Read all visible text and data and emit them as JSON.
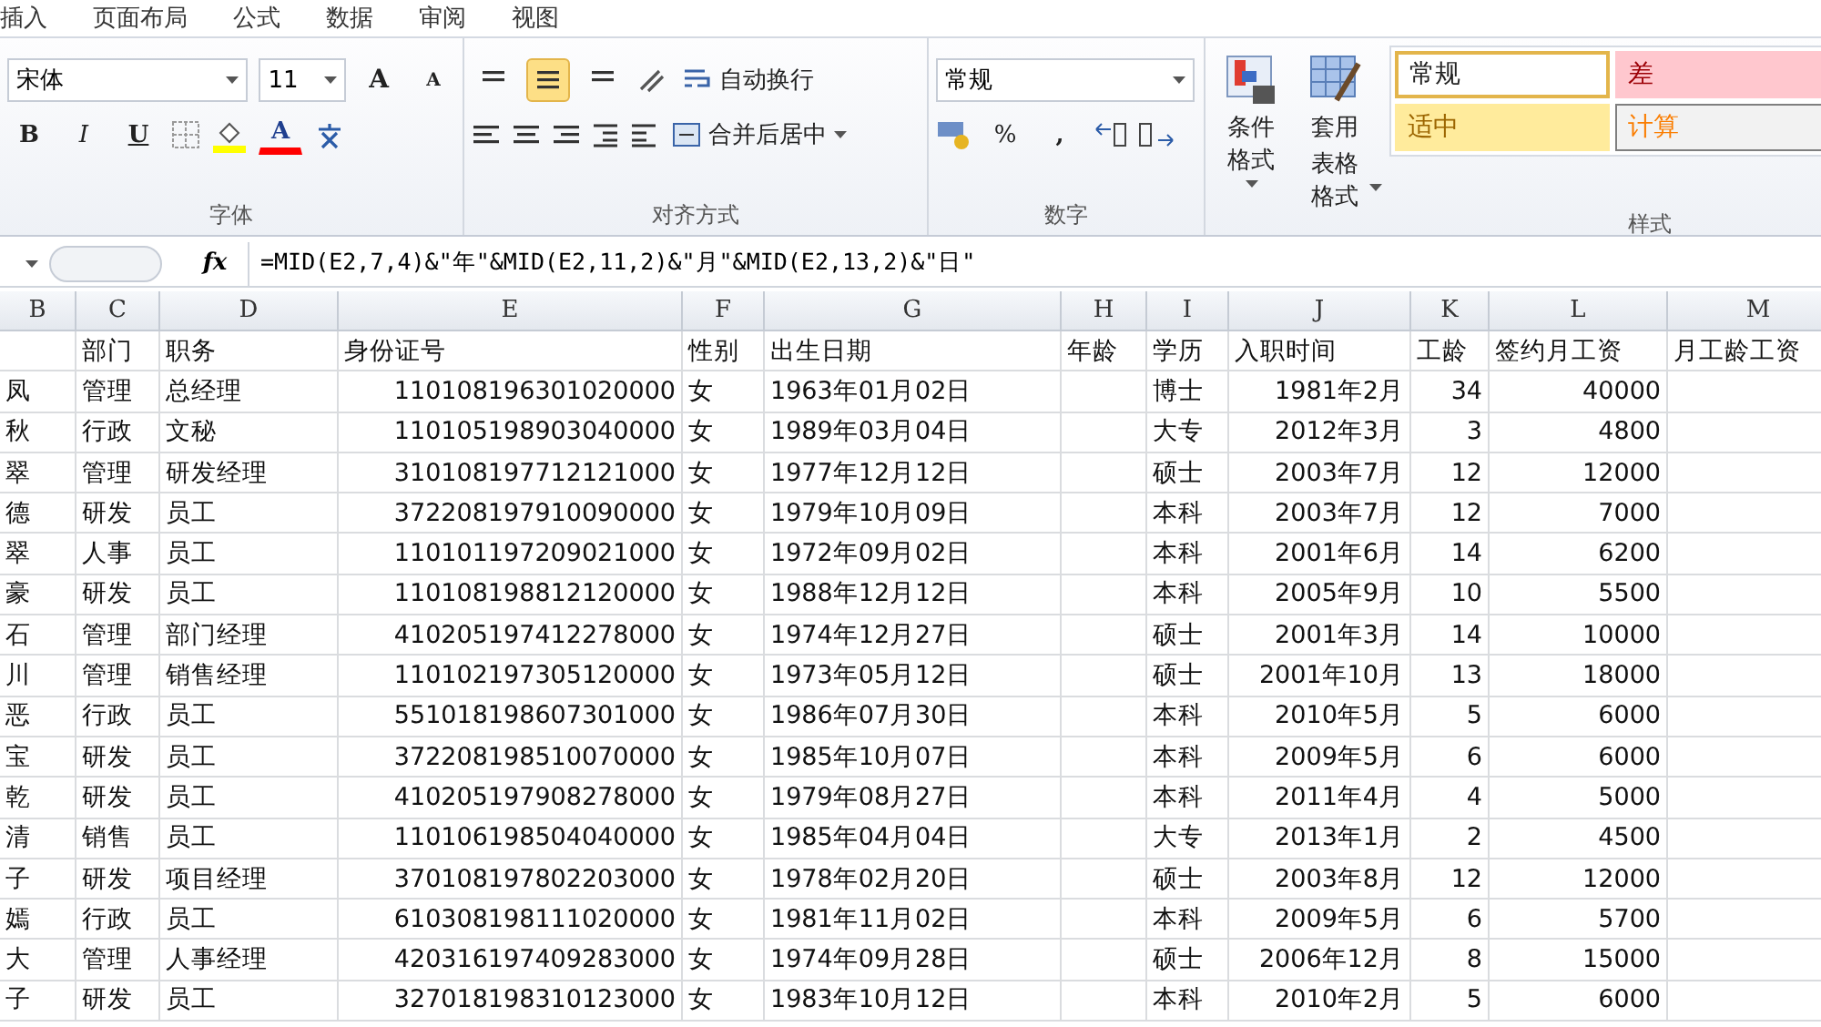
{
  "menu_tabs": [
    "插入",
    "页面布局",
    "公式",
    "数据",
    "审阅",
    "视图"
  ],
  "font_group": {
    "font_name": "宋体",
    "font_size": "11",
    "grow": "A",
    "shrink": "A",
    "bold": "B",
    "italic": "I",
    "underline": "U",
    "font_color": "A",
    "label": "字体"
  },
  "align_group": {
    "vertical": [
      {
        "selected": false
      },
      {
        "selected": true
      },
      {
        "selected": false
      }
    ],
    "wrap_text": "自动换行",
    "merge": "合并后居中",
    "label": "对齐方式"
  },
  "number_group": {
    "format": "常规",
    "percent": "%",
    "comma": ",",
    "label": "数字"
  },
  "styles_group": {
    "conditional": "条件格式",
    "table_format_1": "套用",
    "table_format_2": "表格格式",
    "cell_styles": [
      {
        "label": "常规",
        "kind": "normal",
        "selected": true
      },
      {
        "label": "差",
        "kind": "bad",
        "selected": false
      },
      {
        "label": "适中",
        "kind": "neutral",
        "selected": false
      },
      {
        "label": "计算",
        "kind": "calc",
        "selected": false
      }
    ],
    "label": "样式"
  },
  "formula_bar": {
    "fx": "fx",
    "formula": "=MID(E2,7,4)&\"年\"&MID(E2,11,2)&\"月\"&MID(E2,13,2)&\"日\""
  },
  "columns": [
    "B",
    "C",
    "D",
    "E",
    "F",
    "G",
    "H",
    "I",
    "J",
    "K",
    "L",
    "M"
  ],
  "rows": [
    {
      "C": "部门",
      "D": "职务",
      "E": "身份证号",
      "F": "性别",
      "G": "出生日期",
      "H": "年龄",
      "I": "学历",
      "J": "入职时间",
      "K": "工龄",
      "L": "签约月工资",
      "M": "月工龄工资"
    },
    {
      "B": "凤",
      "C": "管理",
      "D": "总经理",
      "E": "110108196301020000",
      "F": "女",
      "G": "1963年01月02日",
      "I": "博士",
      "J": "1981年2月",
      "K": "34",
      "L": "40000"
    },
    {
      "B": "秋",
      "C": "行政",
      "D": "文秘",
      "E": "110105198903040000",
      "F": "女",
      "G": "1989年03月04日",
      "I": "大专",
      "J": "2012年3月",
      "K": "3",
      "L": "4800"
    },
    {
      "B": "翠",
      "C": "管理",
      "D": "研发经理",
      "E": "310108197712121000",
      "F": "女",
      "G": "1977年12月12日",
      "I": "硕士",
      "J": "2003年7月",
      "K": "12",
      "L": "12000"
    },
    {
      "B": "德",
      "C": "研发",
      "D": "员工",
      "E": "372208197910090000",
      "F": "女",
      "G": "1979年10月09日",
      "I": "本科",
      "J": "2003年7月",
      "K": "12",
      "L": "7000"
    },
    {
      "B": "翠",
      "C": "人事",
      "D": "员工",
      "E": "110101197209021000",
      "F": "女",
      "G": "1972年09月02日",
      "I": "本科",
      "J": "2001年6月",
      "K": "14",
      "L": "6200"
    },
    {
      "B": "豪",
      "C": "研发",
      "D": "员工",
      "E": "110108198812120000",
      "F": "女",
      "G": "1988年12月12日",
      "I": "本科",
      "J": "2005年9月",
      "K": "10",
      "L": "5500"
    },
    {
      "B": "石",
      "C": "管理",
      "D": "部门经理",
      "E": "410205197412278000",
      "F": "女",
      "G": "1974年12月27日",
      "I": "硕士",
      "J": "2001年3月",
      "K": "14",
      "L": "10000"
    },
    {
      "B": "川",
      "C": "管理",
      "D": "销售经理",
      "E": "110102197305120000",
      "F": "女",
      "G": "1973年05月12日",
      "I": "硕士",
      "J": "2001年10月",
      "K": "13",
      "L": "18000"
    },
    {
      "B": "恶",
      "C": "行政",
      "D": "员工",
      "E": "551018198607301000",
      "F": "女",
      "G": "1986年07月30日",
      "I": "本科",
      "J": "2010年5月",
      "K": "5",
      "L": "6000"
    },
    {
      "B": "宝",
      "C": "研发",
      "D": "员工",
      "E": "372208198510070000",
      "F": "女",
      "G": "1985年10月07日",
      "I": "本科",
      "J": "2009年5月",
      "K": "6",
      "L": "6000"
    },
    {
      "B": "乾",
      "C": "研发",
      "D": "员工",
      "E": "410205197908278000",
      "F": "女",
      "G": "1979年08月27日",
      "I": "本科",
      "J": "2011年4月",
      "K": "4",
      "L": "5000"
    },
    {
      "B": "清",
      "C": "销售",
      "D": "员工",
      "E": "110106198504040000",
      "F": "女",
      "G": "1985年04月04日",
      "I": "大专",
      "J": "2013年1月",
      "K": "2",
      "L": "4500"
    },
    {
      "B": "子",
      "C": "研发",
      "D": "项目经理",
      "E": "370108197802203000",
      "F": "女",
      "G": "1978年02月20日",
      "I": "硕士",
      "J": "2003年8月",
      "K": "12",
      "L": "12000"
    },
    {
      "B": "嫣",
      "C": "行政",
      "D": "员工",
      "E": "610308198111020000",
      "F": "女",
      "G": "1981年11月02日",
      "I": "本科",
      "J": "2009年5月",
      "K": "6",
      "L": "5700"
    },
    {
      "B": "大",
      "C": "管理",
      "D": "人事经理",
      "E": "420316197409283000",
      "F": "女",
      "G": "1974年09月28日",
      "I": "硕士",
      "J": "2006年12月",
      "K": "8",
      "L": "15000"
    },
    {
      "B": "子",
      "C": "研发",
      "D": "员工",
      "E": "327018198310123000",
      "F": "女",
      "G": "1983年10月12日",
      "I": "本科",
      "J": "2010年2月",
      "K": "5",
      "L": "6000"
    }
  ]
}
